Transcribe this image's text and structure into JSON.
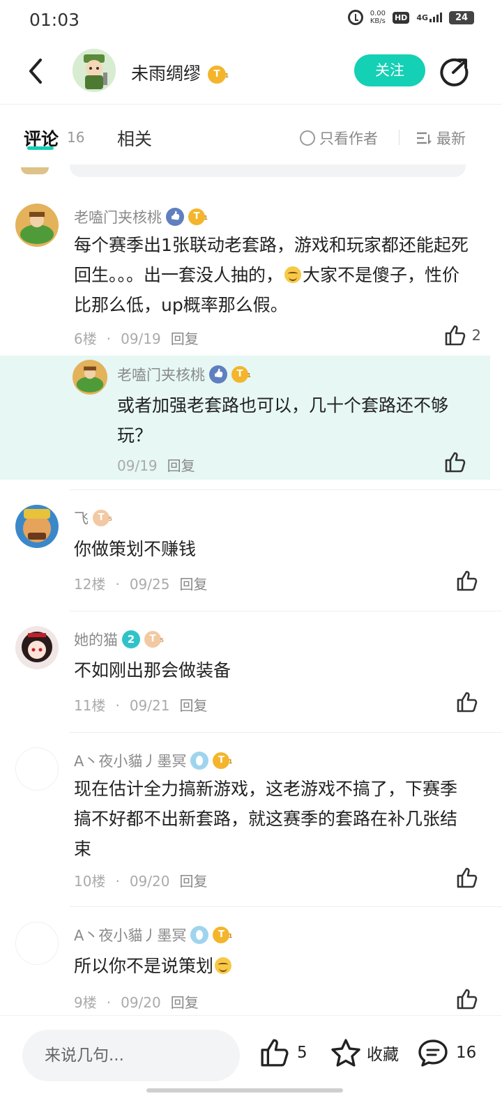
{
  "status_bar": {
    "time": "01:03",
    "speed_value": "0.00",
    "speed_unit": "KB/s",
    "hd": "HD",
    "network": "4G",
    "battery": "24"
  },
  "header": {
    "author_name": "未雨绸缪",
    "author_level": "T",
    "follow_label": "关注"
  },
  "tabs": {
    "comments_label": "评论",
    "comments_count": "16",
    "related_label": "相关",
    "only_author_label": "只看作者",
    "sort_label": "最新"
  },
  "comments": [
    {
      "user": "老嗑门夹核桃",
      "badge": "T",
      "text_a": "每个赛季出1张联动老套路，游戏和玩家都还能起死回生。。。出一套没人抽的，",
      "text_b": "大家不是傻子，性价比那么低，up概率那么假。",
      "floor": "6楼",
      "date": "09/19",
      "reply_label": "回复",
      "likes": "2"
    },
    {
      "user": "老嗑门夹核桃",
      "badge": "T",
      "text": "或者加强老套路也可以，几十个套路还不够玩？",
      "date": "09/19",
      "reply_label": "回复"
    },
    {
      "user": "飞",
      "badge": "T",
      "text": "你做策划不赚钱",
      "floor": "12楼",
      "date": "09/25",
      "reply_label": "回复"
    },
    {
      "user": "她的猫",
      "badge_num": "2",
      "badge": "T",
      "text": "不如刚出那会做装备",
      "floor": "11楼",
      "date": "09/21",
      "reply_label": "回复"
    },
    {
      "user": "A丶夜小貓丿墨冥",
      "badge": "T",
      "text": "现在估计全力搞新游戏，这老游戏不搞了，下赛季搞不好都不出新套路，就这赛季的套路在补几张结束",
      "floor": "10楼",
      "date": "09/20",
      "reply_label": "回复"
    },
    {
      "user": "A丶夜小貓丿墨冥",
      "badge": "T",
      "text": "所以你不是说策划",
      "floor": "9楼",
      "date": "09/20",
      "reply_label": "回复"
    }
  ],
  "meta_dot": "·",
  "bottom_bar": {
    "input_placeholder": "来说几句...",
    "likes": "5",
    "favorite_label": "收藏",
    "comments": "16"
  }
}
